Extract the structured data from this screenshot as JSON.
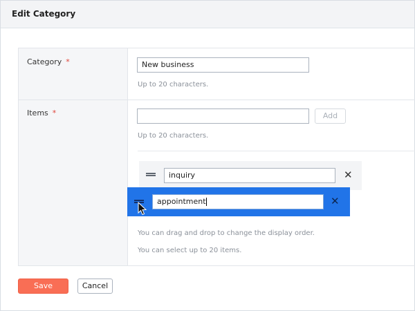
{
  "dialog": {
    "title": "Edit Category"
  },
  "category": {
    "label": "Category",
    "required_mark": "*",
    "value": "New business",
    "hint": "Up to 20 characters."
  },
  "items": {
    "label": "Items",
    "required_mark": "*",
    "new_item_value": "",
    "add_label": "Add",
    "hint": "Up to 20 characters.",
    "list": [
      {
        "value": "inquiry"
      },
      {
        "value": "appointment",
        "state": "dragging"
      }
    ],
    "drag_hint": "You can drag and drop to change the display order.",
    "limit_hint": "You can select up to 20 items."
  },
  "icons": {
    "handle": "drag-handle-icon",
    "remove": "close-icon",
    "cursor": "mouse-pointer-icon",
    "remove_glyph": "✕"
  },
  "footer": {
    "save_label": "Save",
    "cancel_label": "Cancel"
  },
  "colors": {
    "save": "#f96e55",
    "drag_highlight": "#2174e8",
    "required": "#e0443a"
  }
}
